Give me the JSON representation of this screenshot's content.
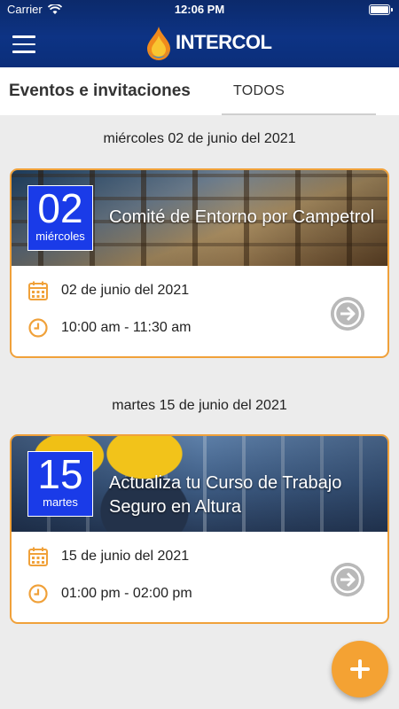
{
  "status_bar": {
    "carrier": "Carrier",
    "time": "12:06 PM"
  },
  "header": {
    "logo_text": "INTERCOL",
    "menu_icon": "hamburger-menu-icon"
  },
  "tabs": {
    "title": "Eventos e invitaciones",
    "active_tab": "TODOS"
  },
  "events": [
    {
      "date_heading": "miércoles 02 de junio del 2021",
      "badge_day": "02",
      "badge_weekday": "miércoles",
      "title": "Comité de Entorno por Campetrol",
      "date": "02 de junio del 2021",
      "time": "10:00 am - 11:30 am"
    },
    {
      "date_heading": "martes 15 de junio del 2021",
      "badge_day": "15",
      "badge_weekday": "martes",
      "title": "Actualiza tu Curso de Trabajo Seguro en Altura",
      "date": "15 de junio del 2021",
      "time": "01:00 pm - 02:00 pm"
    }
  ],
  "fab": {
    "label": "+"
  },
  "colors": {
    "header": "#0d3384",
    "accent": "#f0a13a",
    "badge": "#1a3be8",
    "arrow": "#b9b9b9"
  }
}
